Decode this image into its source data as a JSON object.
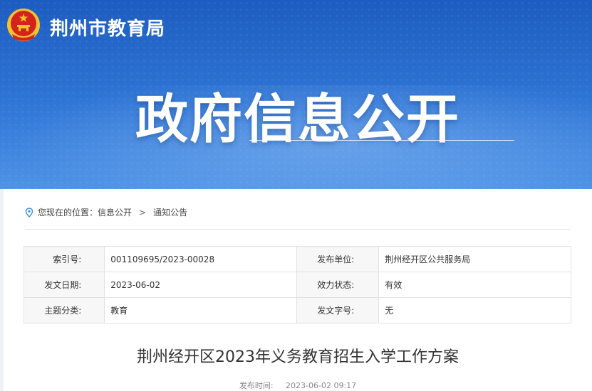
{
  "header": {
    "site_name": "荆州市教育局",
    "hero_title": "政府信息公开"
  },
  "breadcrumb": {
    "prefix": "您现在的位置：",
    "items": [
      "信息公开",
      "通知公告"
    ],
    "separator": ">"
  },
  "meta_table": {
    "rows": [
      {
        "label1": "索引号:",
        "value1": "001109695/2023-00028",
        "label2": "发布单位:",
        "value2": "荆州经开区公共服务局"
      },
      {
        "label1": "发文日期:",
        "value1": "2023-06-02",
        "label2": "效力状态:",
        "value2": "有效"
      },
      {
        "label1": "主题分类:",
        "value1": "教育",
        "label2": "发文字号:",
        "value2": "无"
      }
    ]
  },
  "article": {
    "title": "荆州经开区2023年义务教育招生入学工作方案",
    "time_label": "发布时间:",
    "time_value": "2023-06-02 09:17"
  },
  "colors": {
    "banner_top": "#1d5cc0",
    "banner_bottom": "#4f93e6",
    "emblem_red": "#d3231b",
    "emblem_gold": "#f2c230"
  }
}
